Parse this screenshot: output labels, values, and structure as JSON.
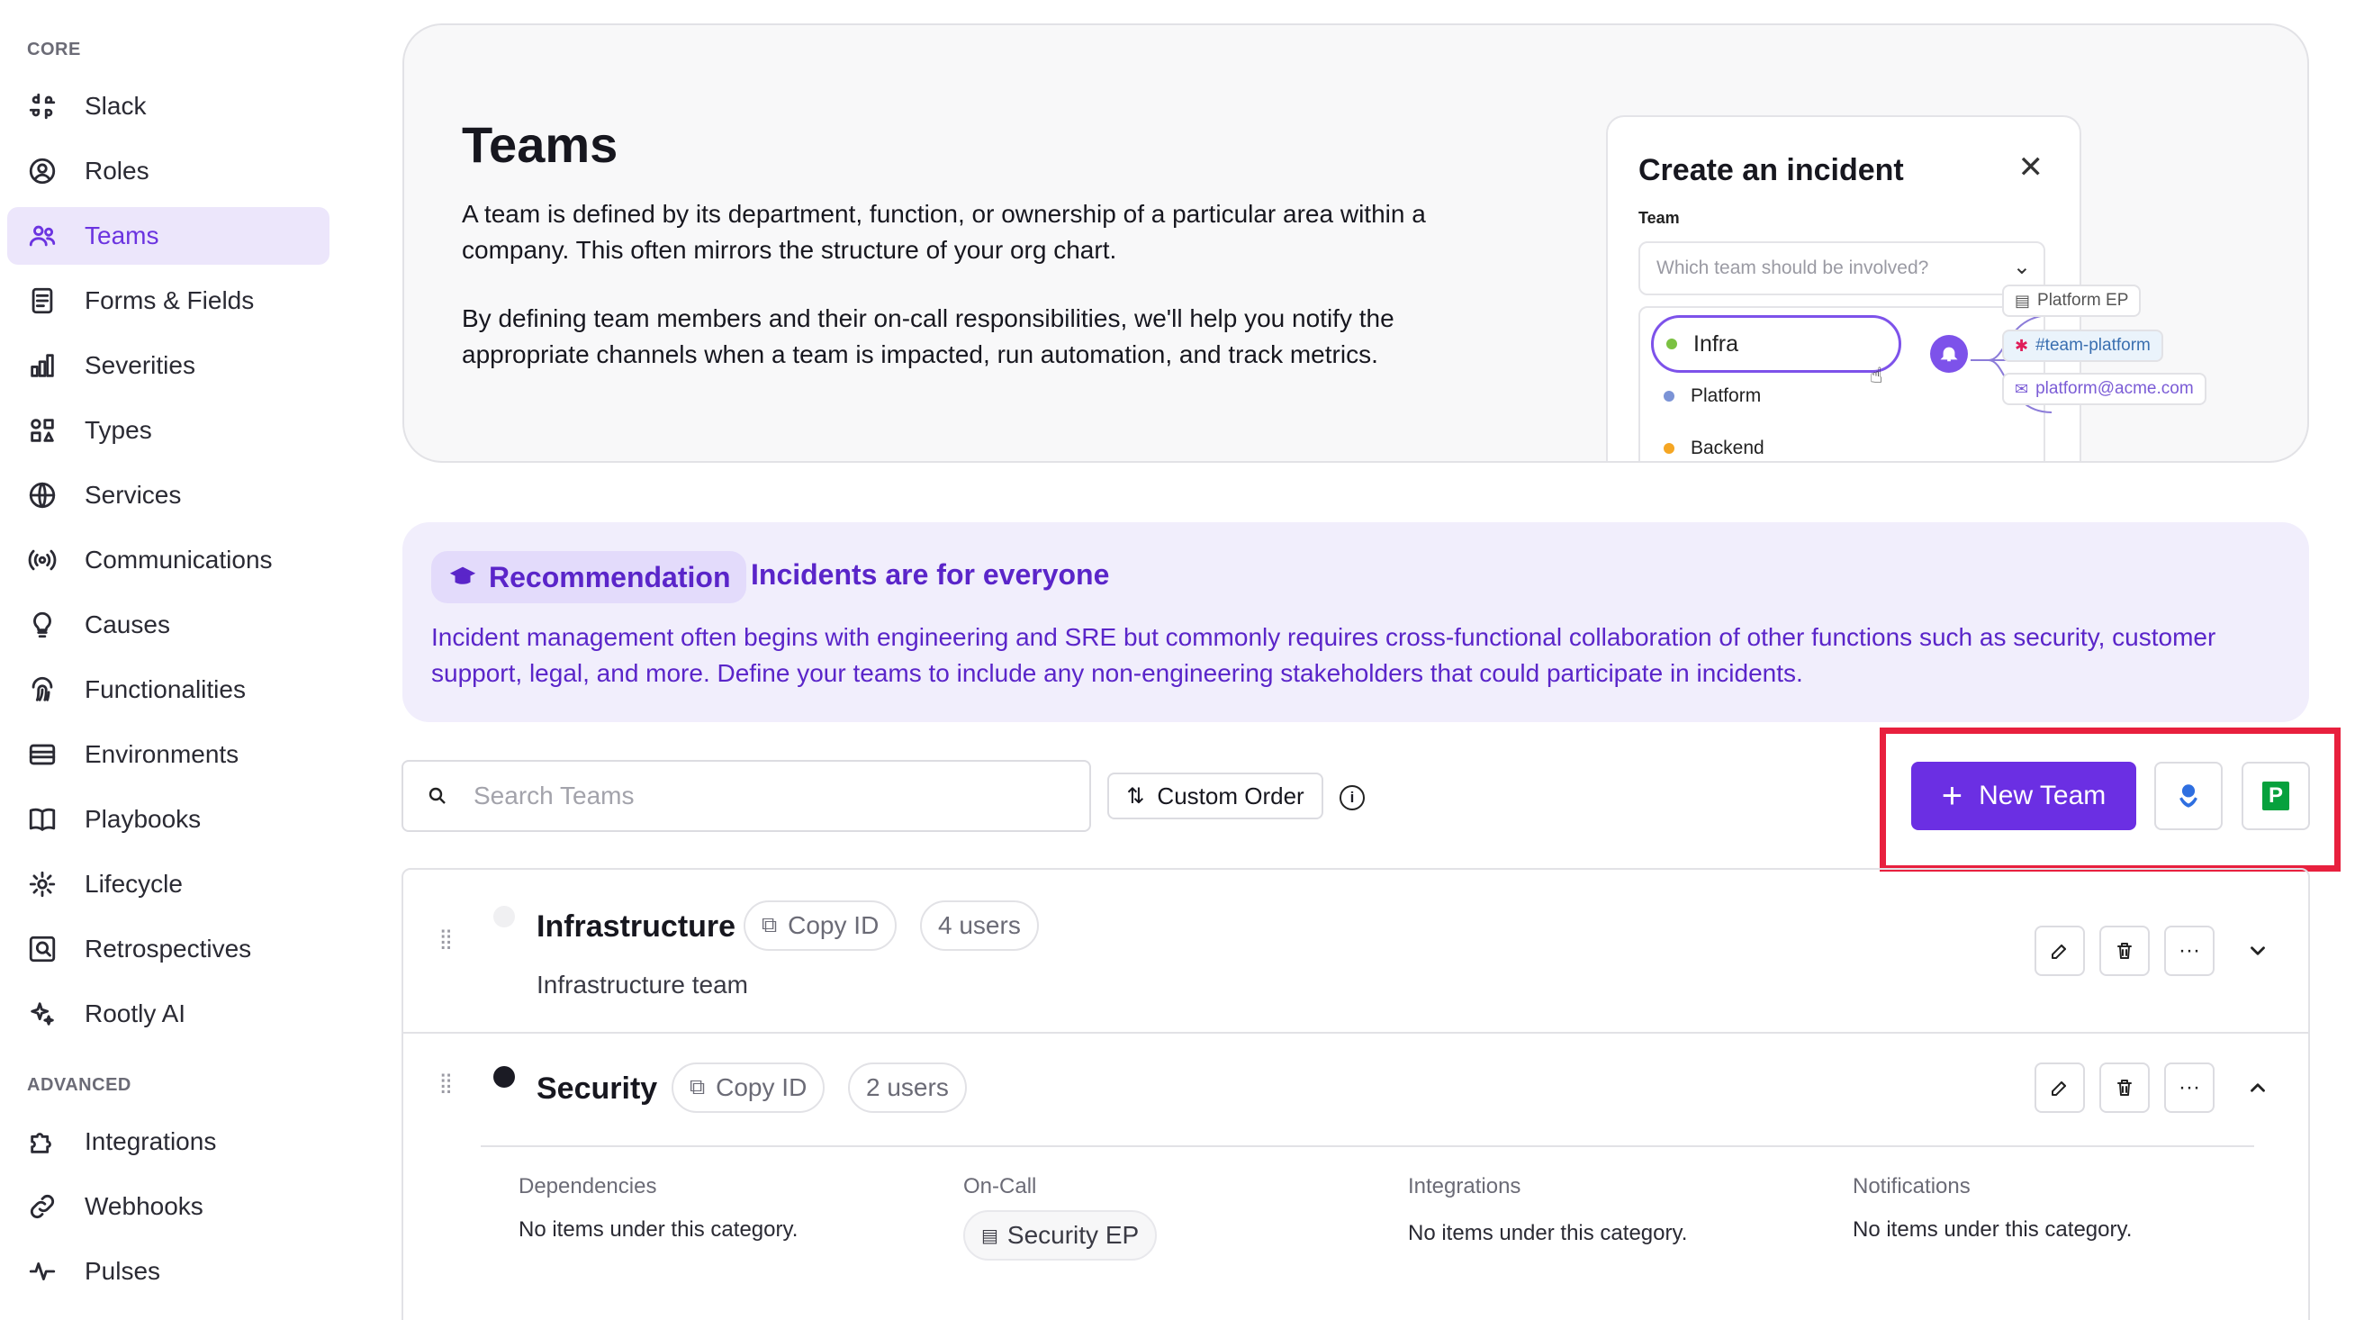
{
  "sidebar": {
    "core_label": "CORE",
    "items": [
      {
        "label": "Slack",
        "icon": "slack-icon"
      },
      {
        "label": "Roles",
        "icon": "user-circle-icon"
      },
      {
        "label": "Teams",
        "icon": "users-icon",
        "active": true
      },
      {
        "label": "Forms & Fields",
        "icon": "form-icon"
      },
      {
        "label": "Severities",
        "icon": "bar-chart-icon"
      },
      {
        "label": "Types",
        "icon": "shapes-icon"
      },
      {
        "label": "Services",
        "icon": "globe-icon"
      },
      {
        "label": "Communications",
        "icon": "broadcast-icon"
      },
      {
        "label": "Causes",
        "icon": "lightbulb-icon"
      },
      {
        "label": "Functionalities",
        "icon": "fingerprint-icon"
      },
      {
        "label": "Environments",
        "icon": "server-icon"
      },
      {
        "label": "Playbooks",
        "icon": "book-icon"
      },
      {
        "label": "Lifecycle",
        "icon": "lifecycle-icon"
      },
      {
        "label": "Retrospectives",
        "icon": "retrospective-icon"
      },
      {
        "label": "Rootly AI",
        "icon": "sparkle-icon"
      }
    ],
    "advanced_label": "ADVANCED",
    "advanced_items": [
      {
        "label": "Integrations",
        "icon": "puzzle-icon"
      },
      {
        "label": "Webhooks",
        "icon": "link-icon"
      },
      {
        "label": "Pulses",
        "icon": "pulse-icon"
      }
    ]
  },
  "hero": {
    "title": "Teams",
    "p1": "A team is defined by its department, function, or ownership of a particular area within a company. This often mirrors the structure of your org chart.",
    "p2": "By defining team members and their on-call responsibilities, we'll help you notify the appropriate channels when a team is impacted, run automation, and track metrics.",
    "mock": {
      "title": "Create an incident",
      "field_label": "Team",
      "placeholder": "Which team should be involved?",
      "options": [
        {
          "label": "Infra",
          "color": "#7bc142"
        },
        {
          "label": "Platform",
          "color": "#7b93d6"
        },
        {
          "label": "Backend",
          "color": "#f5a623"
        }
      ],
      "chips": [
        "Platform EP",
        "#team-platform",
        "platform@acme.com"
      ]
    }
  },
  "recommendation": {
    "badge": "Recommendation",
    "heading": "Incidents are for everyone",
    "text": "Incident management often begins with engineering and SRE but commonly requires cross-functional collaboration of other functions such as security, customer support, legal, and more. Define your teams to include any non-engineering stakeholders that could participate in incidents."
  },
  "toolbar": {
    "search_placeholder": "Search Teams",
    "order_label": "Custom Order",
    "new_team_label": "New Team",
    "pagerduty_letter": "P"
  },
  "teams": [
    {
      "name": "Infrastructure",
      "copy_label": "Copy ID",
      "users": "4 users",
      "description": "Infrastructure team",
      "color": "#f0f0f2"
    },
    {
      "name": "Security",
      "copy_label": "Copy ID",
      "users": "2 users",
      "color": "#1b1b24",
      "details": {
        "dependencies_label": "Dependencies",
        "dependencies_value": "No items under this category.",
        "oncall_label": "On-Call",
        "oncall_value": "Security EP",
        "integrations_label": "Integrations",
        "integrations_value": "No items under this category.",
        "notifications_label": "Notifications",
        "notifications_value": "No items under this category."
      }
    }
  ],
  "colors": {
    "accent": "#6b2fe3",
    "highlight": "#e8203e",
    "recommendation_bg": "#f1eefc"
  }
}
